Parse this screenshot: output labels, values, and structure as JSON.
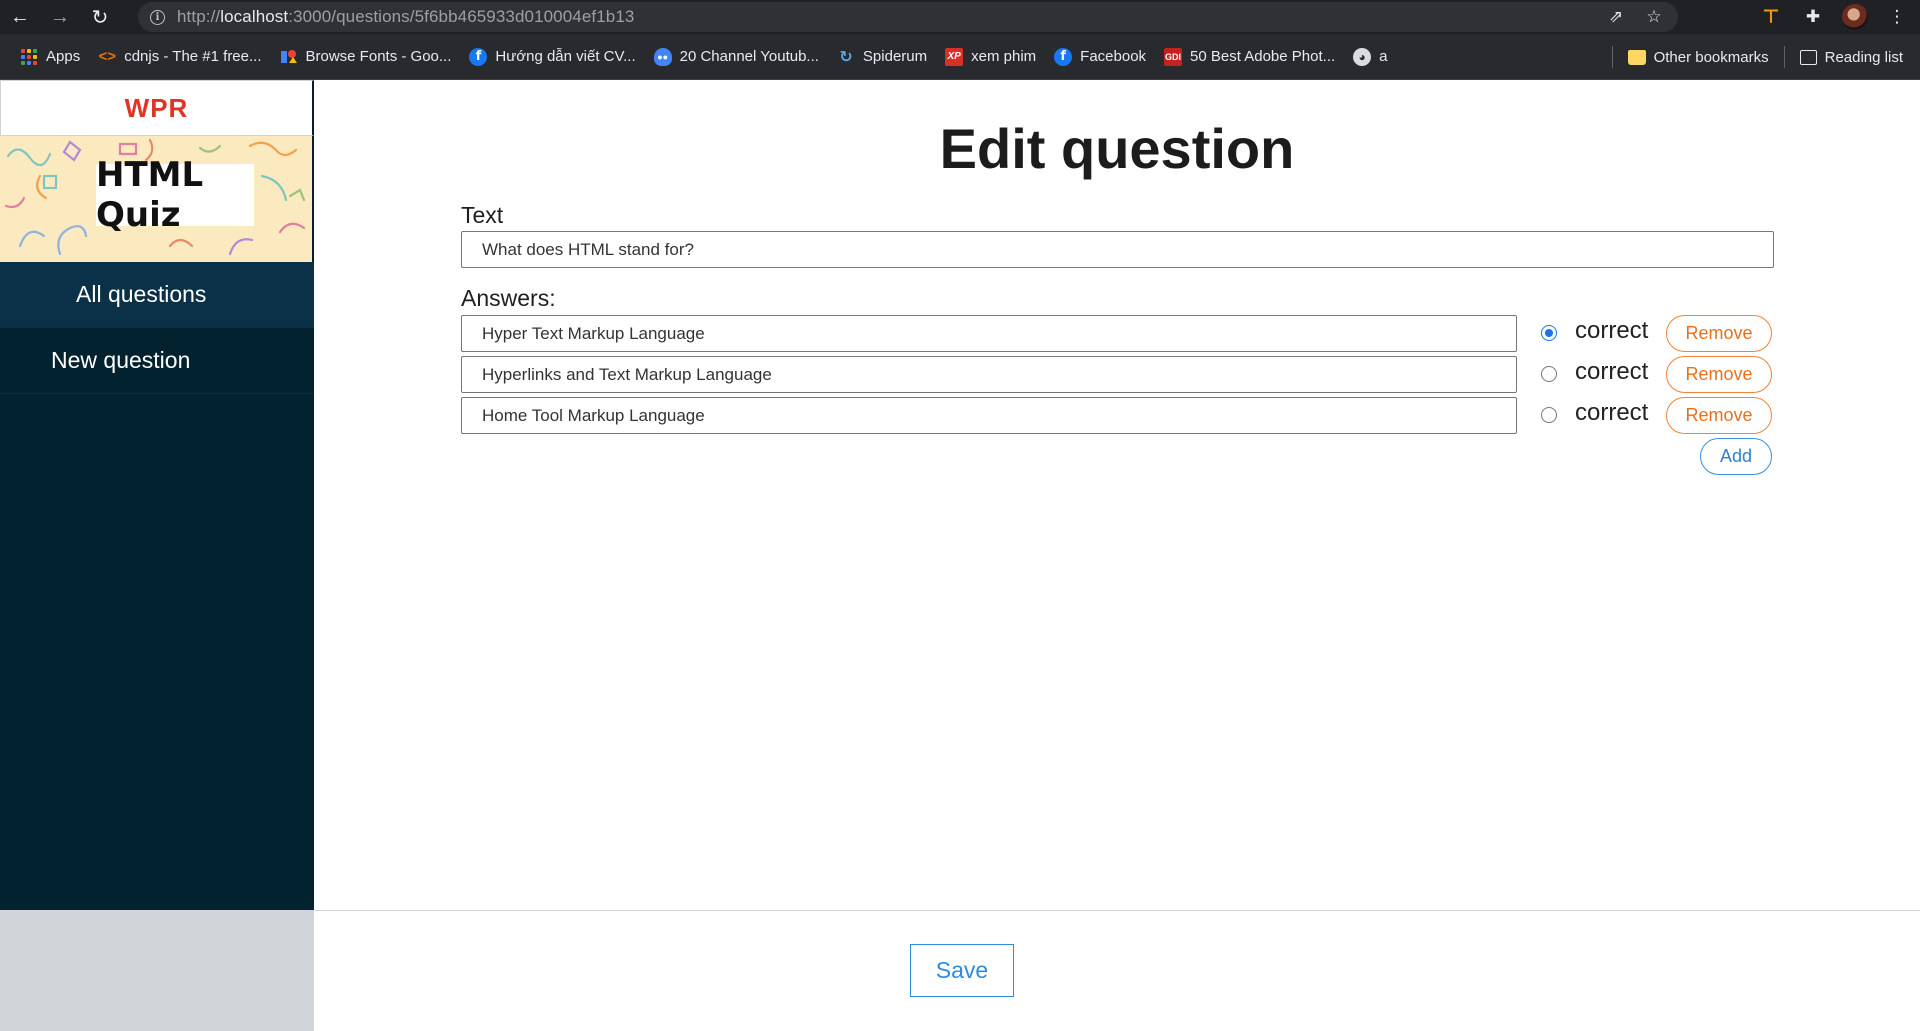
{
  "browser": {
    "url_scheme": "http://",
    "url_host": "localhost",
    "url_path": ":3000/questions/5f6bb465933d010004ef1b13",
    "bookmarks": [
      {
        "label": "Apps",
        "icon": "apps-grid-icon"
      },
      {
        "label": "cdnjs - The #1 free...",
        "icon": "code-brackets-icon"
      },
      {
        "label": "Browse Fonts - Goo...",
        "icon": "google-fonts-icon"
      },
      {
        "label": "Hướng dẫn viết CV...",
        "icon": "facebook-icon"
      },
      {
        "label": "20 Channel Youtub...",
        "icon": "ghost-icon"
      },
      {
        "label": "Spiderum",
        "icon": "spiderum-icon"
      },
      {
        "label": "xem phim",
        "icon": "xp-icon"
      },
      {
        "label": "Facebook",
        "icon": "facebook-icon"
      },
      {
        "label": "50 Best Adobe Phot...",
        "icon": "gdi-icon"
      },
      {
        "label": "a",
        "icon": "globe-icon"
      }
    ],
    "other_bookmarks": "Other bookmarks",
    "reading_list": "Reading list"
  },
  "sidebar": {
    "brand": "WPR",
    "banner_title": "HTML Quiz",
    "nav": [
      {
        "label": "All questions",
        "active": true
      },
      {
        "label": "New question",
        "active": false
      }
    ]
  },
  "form": {
    "title": "Edit question",
    "text_label": "Text",
    "text_value": "What does HTML stand for?",
    "answers_label": "Answers:",
    "correct_label": "correct",
    "remove_label": "Remove",
    "add_label": "Add",
    "answers": [
      {
        "text": "Hyper Text Markup Language",
        "correct": true
      },
      {
        "text": "Hyperlinks and Text Markup Language",
        "correct": false
      },
      {
        "text": "Home Tool Markup Language",
        "correct": false
      }
    ],
    "save_label": "Save"
  },
  "colors": {
    "brand_red": "#e03427",
    "nav_background": "#03222f",
    "remove_orange": "#e8701a",
    "add_blue": "#2f7fd1",
    "radio_blue": "#1a73e8"
  }
}
